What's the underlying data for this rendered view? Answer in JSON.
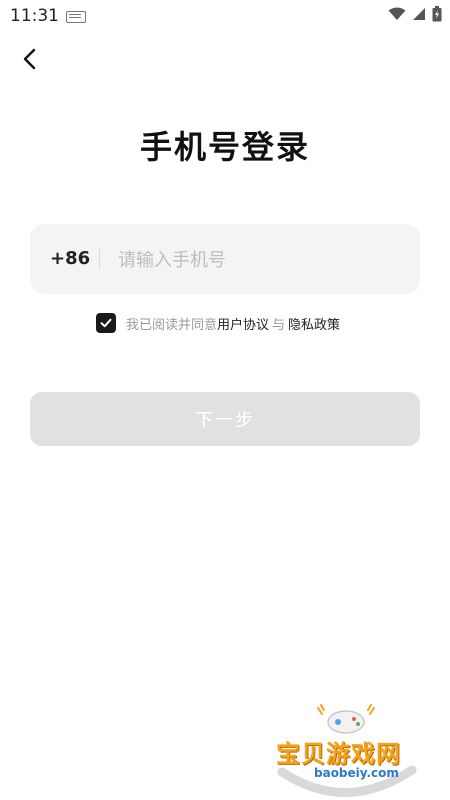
{
  "status_bar": {
    "time": "11:31"
  },
  "header": {
    "title": "手机号登录"
  },
  "phone": {
    "country_code": "+86",
    "placeholder": "请输入手机号",
    "value": ""
  },
  "agreement": {
    "checked": true,
    "prefix": "我已阅读并同意",
    "user_agreement": "用户协议",
    "conjunction": "与",
    "privacy_policy": "隐私政策"
  },
  "next_button": {
    "label": "下一步",
    "enabled": false
  },
  "watermark": {
    "name": "宝贝游戏网",
    "url": "baobeiy.com"
  },
  "colors": {
    "background": "#ffffff",
    "input_bg": "#f4f4f4",
    "button_disabled": "#e1e1e1",
    "checkbox": "#1a1a1a",
    "muted_text": "#9a9a9a"
  }
}
